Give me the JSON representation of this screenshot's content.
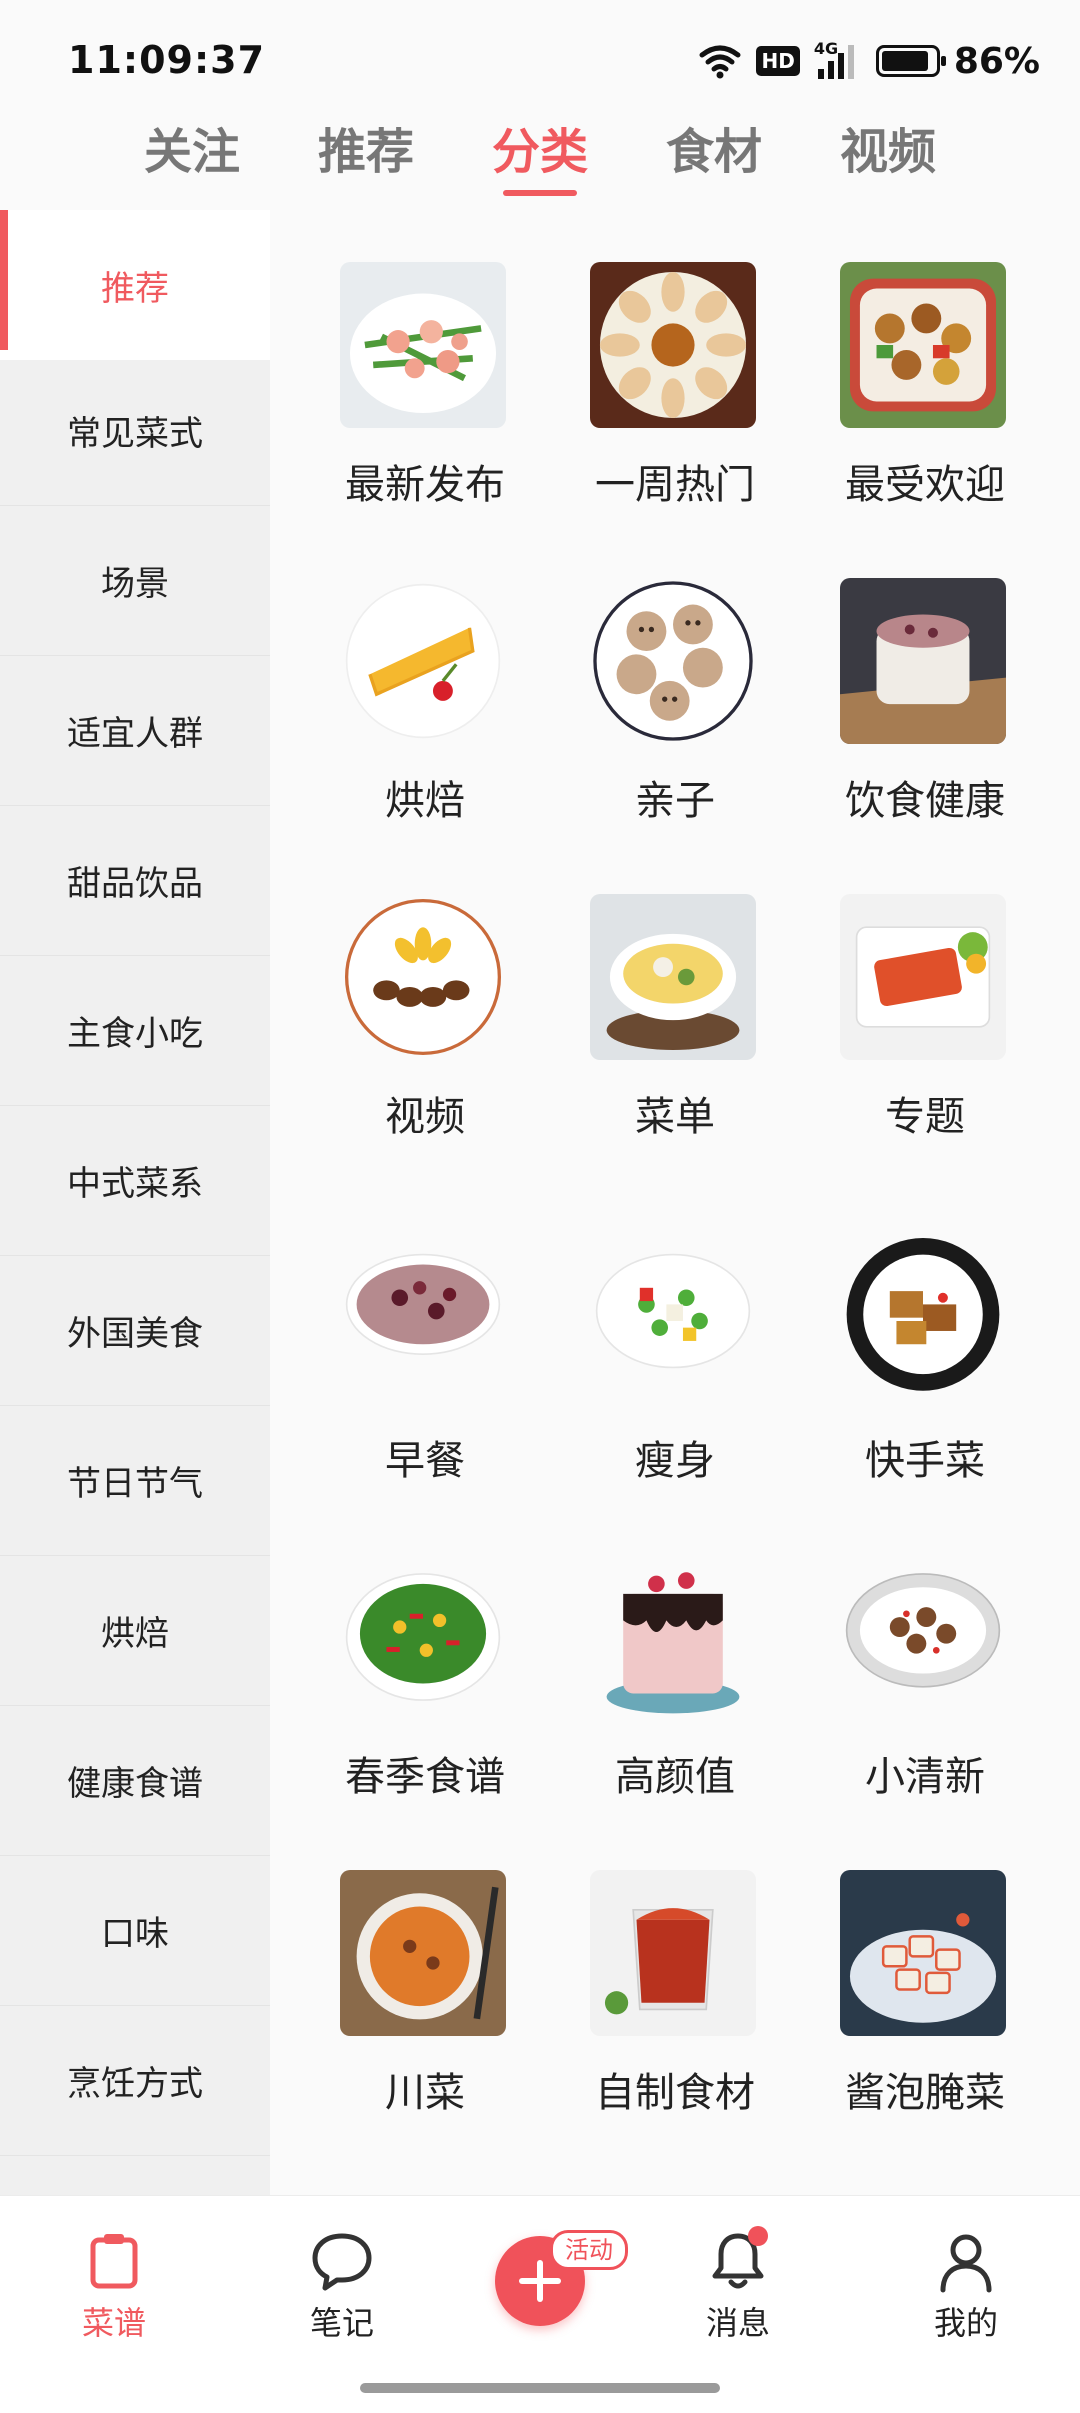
{
  "status": {
    "time": "11:09:37",
    "hd": "HD",
    "network": "4G",
    "battery": "86%"
  },
  "colors": {
    "accent": "#f05a5f",
    "sidebar_bg": "#f0f0f0",
    "page_bg": "#fafafa"
  },
  "top_tabs": [
    {
      "label": "关注",
      "active": false
    },
    {
      "label": "推荐",
      "active": false
    },
    {
      "label": "分类",
      "active": true
    },
    {
      "label": "食材",
      "active": false
    },
    {
      "label": "视频",
      "active": false
    }
  ],
  "sidebar": {
    "items": [
      {
        "label": "推荐",
        "active": true
      },
      {
        "label": "常见菜式"
      },
      {
        "label": "场景"
      },
      {
        "label": "适宜人群"
      },
      {
        "label": "甜品饮品"
      },
      {
        "label": "主食小吃"
      },
      {
        "label": "中式菜系"
      },
      {
        "label": "外国美食"
      },
      {
        "label": "节日节气"
      },
      {
        "label": "烘焙"
      },
      {
        "label": "健康食谱"
      },
      {
        "label": "口味"
      },
      {
        "label": "烹饪方式"
      }
    ]
  },
  "grid": {
    "items": [
      {
        "label": "最新发布",
        "icon": "shrimp-dish-photo"
      },
      {
        "label": "一周热门",
        "icon": "rolls-platter-photo"
      },
      {
        "label": "最受欢迎",
        "icon": "braised-dish-photo"
      },
      {
        "label": "烘焙",
        "icon": "cheesecake-photo"
      },
      {
        "label": "亲子",
        "icon": "bear-cookies-photo"
      },
      {
        "label": "饮食健康",
        "icon": "porridge-cup-photo"
      },
      {
        "label": "视频",
        "icon": "grilled-plate-photo"
      },
      {
        "label": "菜单",
        "icon": "soup-bowl-photo"
      },
      {
        "label": "专题",
        "icon": "toast-plate-photo"
      },
      {
        "label": "早餐",
        "icon": "bean-porridge-photo"
      },
      {
        "label": "瘦身",
        "icon": "vegetable-plate-photo"
      },
      {
        "label": "快手菜",
        "icon": "fried-tofu-photo"
      },
      {
        "label": "春季食谱",
        "icon": "green-salad-photo"
      },
      {
        "label": "高颜值",
        "icon": "drip-cake-photo"
      },
      {
        "label": "小清新",
        "icon": "stir-fry-plate-photo"
      },
      {
        "label": "川菜",
        "icon": "spicy-soup-photo"
      },
      {
        "label": "自制食材",
        "icon": "jam-jar-photo"
      },
      {
        "label": "酱泡腌菜",
        "icon": "pickled-radish-photo"
      }
    ]
  },
  "bottom_nav": {
    "recipes": "菜谱",
    "notes": "笔记",
    "badge": "活动",
    "messages": "消息",
    "mine": "我的"
  }
}
